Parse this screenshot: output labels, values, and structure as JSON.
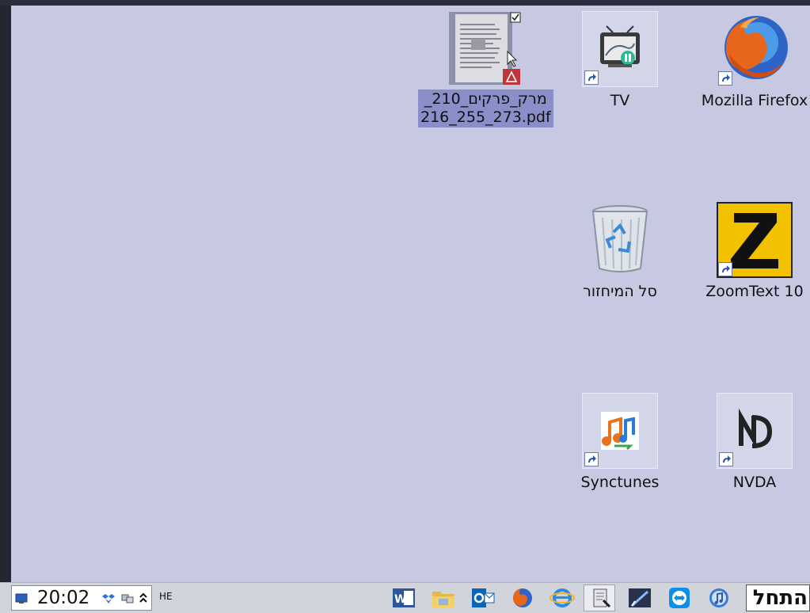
{
  "desktop": {
    "icons": {
      "pdf": {
        "label_line1": "_מרק_פרקים_210",
        "label_line2": "216_255_273.pdf"
      },
      "tv": {
        "label": "TV"
      },
      "firefox": {
        "label": "Mozilla Firefox"
      },
      "recycle": {
        "label": "סל המיחזור"
      },
      "zoomtext": {
        "label": "ZoomText 10"
      },
      "synctunes": {
        "label": "Synctunes"
      },
      "nvda": {
        "label": "NVDA"
      }
    }
  },
  "taskbar": {
    "clock": "20:02",
    "language": "HE",
    "start_label": "התחל",
    "items": [
      "word-icon",
      "file-explorer-icon",
      "outlook-icon",
      "firefox-icon",
      "internet-explorer-icon",
      "document-viewer-icon",
      "pen-tool-icon",
      "teamviewer-icon",
      "itunes-icon"
    ]
  },
  "colors": {
    "desktop": "#c7c9e2",
    "selection": "#8a8fc9",
    "taskbar": "#d2d4dc"
  }
}
